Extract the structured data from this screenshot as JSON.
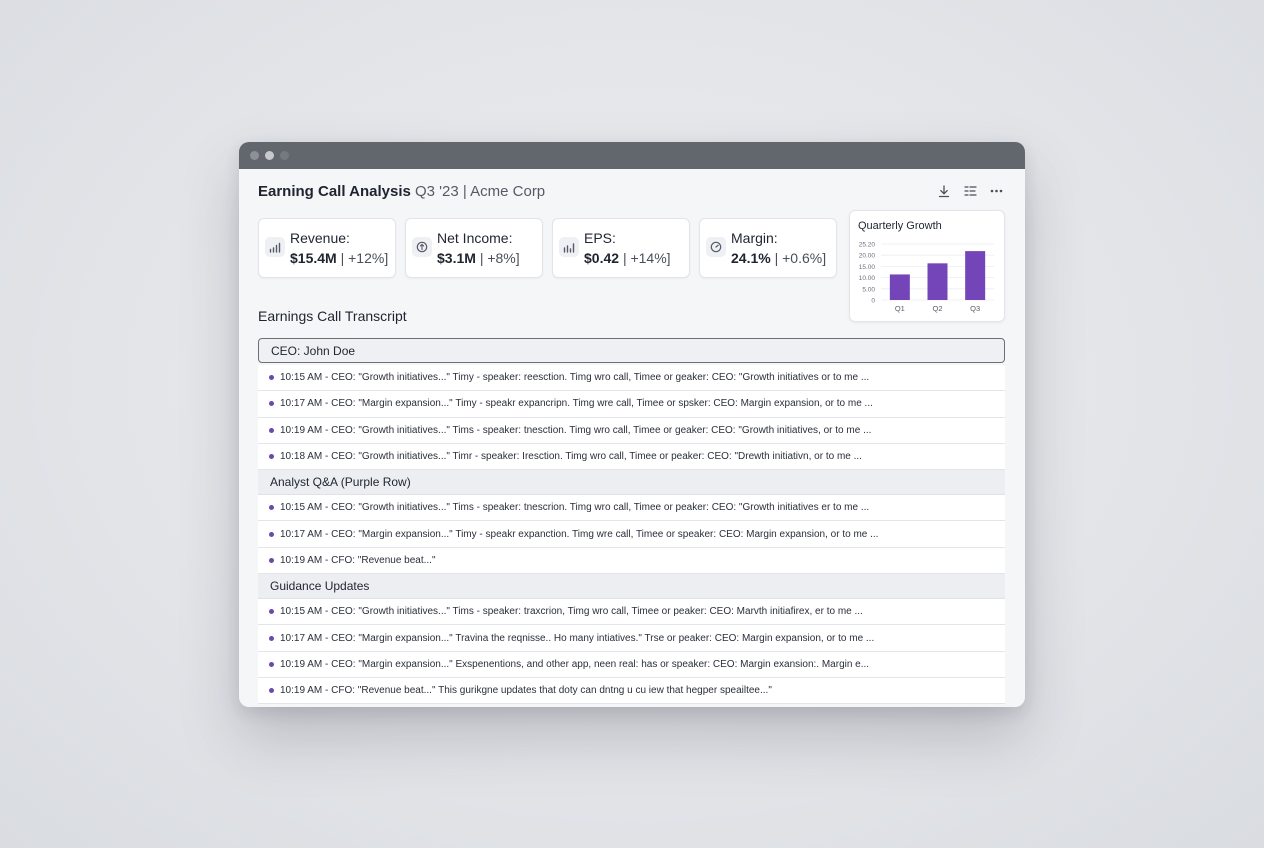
{
  "header": {
    "title": "Earning Call Analysis",
    "subtitle": "Q3 '23 | Acme Corp",
    "actions": [
      {
        "name": "download-icon",
        "glyph": "↓"
      },
      {
        "name": "list-filter-icon",
        "glyph": "≡"
      },
      {
        "name": "more-icon",
        "glyph": "⋯"
      }
    ]
  },
  "kpis": [
    {
      "label": "Revenue:",
      "value": "$15.4M",
      "change": "| +12%]",
      "icon": "bar-chart-icon"
    },
    {
      "label": "Net Income:",
      "value": "$3.1M",
      "change": "| +8%]",
      "icon": "coin-icon"
    },
    {
      "label": "EPS:",
      "value": "$0.42",
      "change": "| +14%]",
      "icon": "bar-chart-icon"
    },
    {
      "label": "Margin:",
      "value": "24.1%",
      "change": "| +0.6%]",
      "icon": "gauge-icon"
    }
  ],
  "chart_data": {
    "type": "bar",
    "title": "Quarterly Growth",
    "categories": [
      "Q1",
      "Q2",
      "Q3"
    ],
    "values": [
      1150,
      1650,
      2200
    ],
    "yticks": [
      "0",
      "5.00",
      "10.00",
      "15.00",
      "20.00",
      "25.20"
    ],
    "ylim": [
      0,
      2520
    ],
    "color": "#7345b8",
    "grid": true
  },
  "transcript": {
    "title": "Earnings Call Transcript",
    "groups": [
      {
        "header": "CEO: John Doe",
        "selected": true,
        "rows": [
          "10:15 AM - CEO: \"Growth initiatives...\" Timy - speaker: reesction. Timg wro call, Timee or geaker: CEO: \"Growth initiatives or to me ...",
          "10:17 AM - CEO: \"Margin expansion...\" Timy - speakr expancripn. Timg wre call, Timee or spsker: CEO: Margin expansion, or to me ...",
          "10:19 AM - CEO: \"Growth initiatives...\" Tims - speaker: tnesction. Timg wro call, Timee or geaker: CEO: \"Growth initiatives, or to me ...",
          "10:18 AM - CEO: \"Growth initiatives...\" Timr - speaker: Iresction. Timg wro call, Timee or peaker: CEO: \"Drewth initiativn, or to me ..."
        ]
      },
      {
        "header": "Analyst Q&A (Purple Row)",
        "selected": false,
        "rows": [
          "10:15 AM - CEO: \"Growth initiatives...\" Tims - speaker: tnescrion. Timg wro call, Timee or peaker: CEO: \"Growth initiatives er to me ...",
          "10:17 AM - CEO: \"Margin expansion...\" Timy - speakr expanction. Timg wre call, Timee or speaker: CEO: Margin expansion, or to me ...",
          "10:19 AM - CFO: \"Revenue beat...\""
        ]
      },
      {
        "header": "Guidance Updates",
        "selected": false,
        "rows": [
          "10:15 AM - CEO: \"Growth initiatives...\" Tims - speaker: traxcrion, Timg wro call, Timee or peaker: CEO: Marvth initiafirex, er to me ...",
          "10:17 AM - CEO: \"Margin expansion...\" Travina the reqnisse.. Ho many intiatives.\" Trse or peaker: CEO: Margin expansion, or to me ...",
          "10:19 AM - CEO: \"Margin expansion...\" Exspenentions, and other app, neen real: has or speaker: CEO: Margin exansion:. Margin e...",
          "10:19 AM - CFO: \"Revenue beat...\" This gurikgne updates that doty can dntng u cu iew that hegper speailtee...\""
        ]
      }
    ]
  }
}
